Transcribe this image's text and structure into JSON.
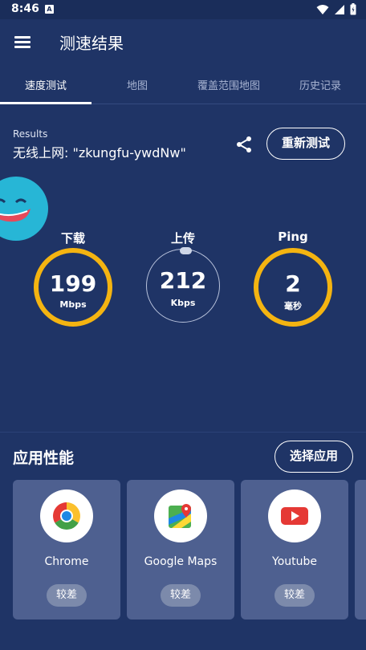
{
  "status_bar": {
    "time": "8:46",
    "app_icon_letter": "A",
    "icons": [
      "wifi-icon",
      "signal-icon",
      "battery-icon"
    ]
  },
  "app_bar": {
    "title": "测速结果",
    "menu_icon": "menu-icon"
  },
  "tabs": [
    {
      "label": "速度测试",
      "active": true
    },
    {
      "label": "地图",
      "active": false
    },
    {
      "label": "覆盖范围地图",
      "active": false
    },
    {
      "label": "历史记录",
      "active": false
    }
  ],
  "results": {
    "label": "Results",
    "network_name": "无线上网: \"zkungfu-ywdNw\"",
    "share_icon": "share-icon",
    "retest_label": "重新测试"
  },
  "metrics": [
    {
      "label": "下载",
      "value": "199",
      "unit": "Mbps"
    },
    {
      "label": "上传",
      "value": "212",
      "unit": "Kbps"
    },
    {
      "label": "Ping",
      "value": "2",
      "unit": "毫秒"
    }
  ],
  "performance": {
    "title": "应用性能",
    "choose_label": "选择应用",
    "apps": [
      {
        "name": "Chrome",
        "status": "较差",
        "icon": "chrome-icon"
      },
      {
        "name": "Google Maps",
        "status": "较差",
        "icon": "google-maps-icon"
      },
      {
        "name": "Youtube",
        "status": "较差",
        "icon": "youtube-icon"
      }
    ]
  },
  "colors": {
    "background": "#1f3466",
    "gauge_accent": "#f4b411",
    "card": "#4e6090"
  }
}
